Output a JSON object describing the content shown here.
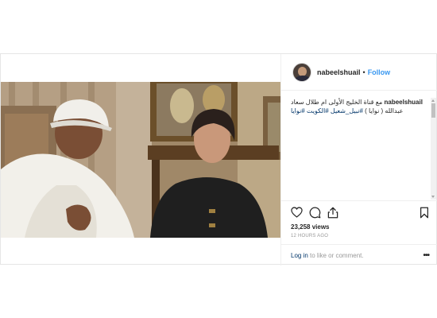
{
  "author": {
    "username": "nabeelshuail",
    "separator": "•",
    "follow_label": "Follow"
  },
  "caption": {
    "username": "nabeelshuail",
    "text": "مع قناة الخليج الأولى ام طلال سعاد عبدالله ( نوايا ) ",
    "hashtags": "#نبيل_شعيل #الكويت #نوايا"
  },
  "stats": {
    "views": "23,258 views",
    "time": "12 HOURS AGO"
  },
  "login": {
    "link_label": "Log in",
    "suffix": " to like or comment.",
    "more_label": "•••"
  },
  "icons": {
    "like": "heart-icon",
    "comment": "comment-icon",
    "share": "share-icon",
    "save": "bookmark-icon",
    "more": "more-options-icon"
  },
  "colors": {
    "link": "#3897f0",
    "hashtag": "#003569",
    "muted": "#999999",
    "text": "#262626"
  }
}
